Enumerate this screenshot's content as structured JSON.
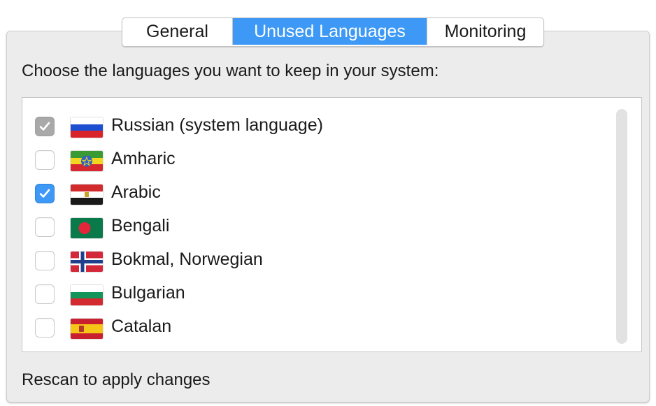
{
  "tabs": {
    "general": "General",
    "unused_languages": "Unused Languages",
    "monitoring": "Monitoring",
    "selected": "Unused Languages"
  },
  "prompt": "Choose the languages you want to keep in your system:",
  "languages": [
    {
      "label": "Russian (system language)",
      "checked": true,
      "enabled": false,
      "flag": "russia-flag"
    },
    {
      "label": "Amharic",
      "checked": false,
      "enabled": true,
      "flag": "ethiopia-flag"
    },
    {
      "label": "Arabic",
      "checked": true,
      "enabled": true,
      "flag": "egypt-flag"
    },
    {
      "label": "Bengali",
      "checked": false,
      "enabled": true,
      "flag": "bangladesh-flag"
    },
    {
      "label": "Bokmal, Norwegian",
      "checked": false,
      "enabled": true,
      "flag": "norway-flag"
    },
    {
      "label": "Bulgarian",
      "checked": false,
      "enabled": true,
      "flag": "bulgaria-flag"
    },
    {
      "label": "Catalan",
      "checked": false,
      "enabled": true,
      "flag": "spain-flag"
    }
  ],
  "status": "Rescan to apply changes",
  "colors": {
    "accent": "#3d99f5",
    "panel_bg": "#ececec",
    "disabled_check": "#a9a9a9"
  }
}
